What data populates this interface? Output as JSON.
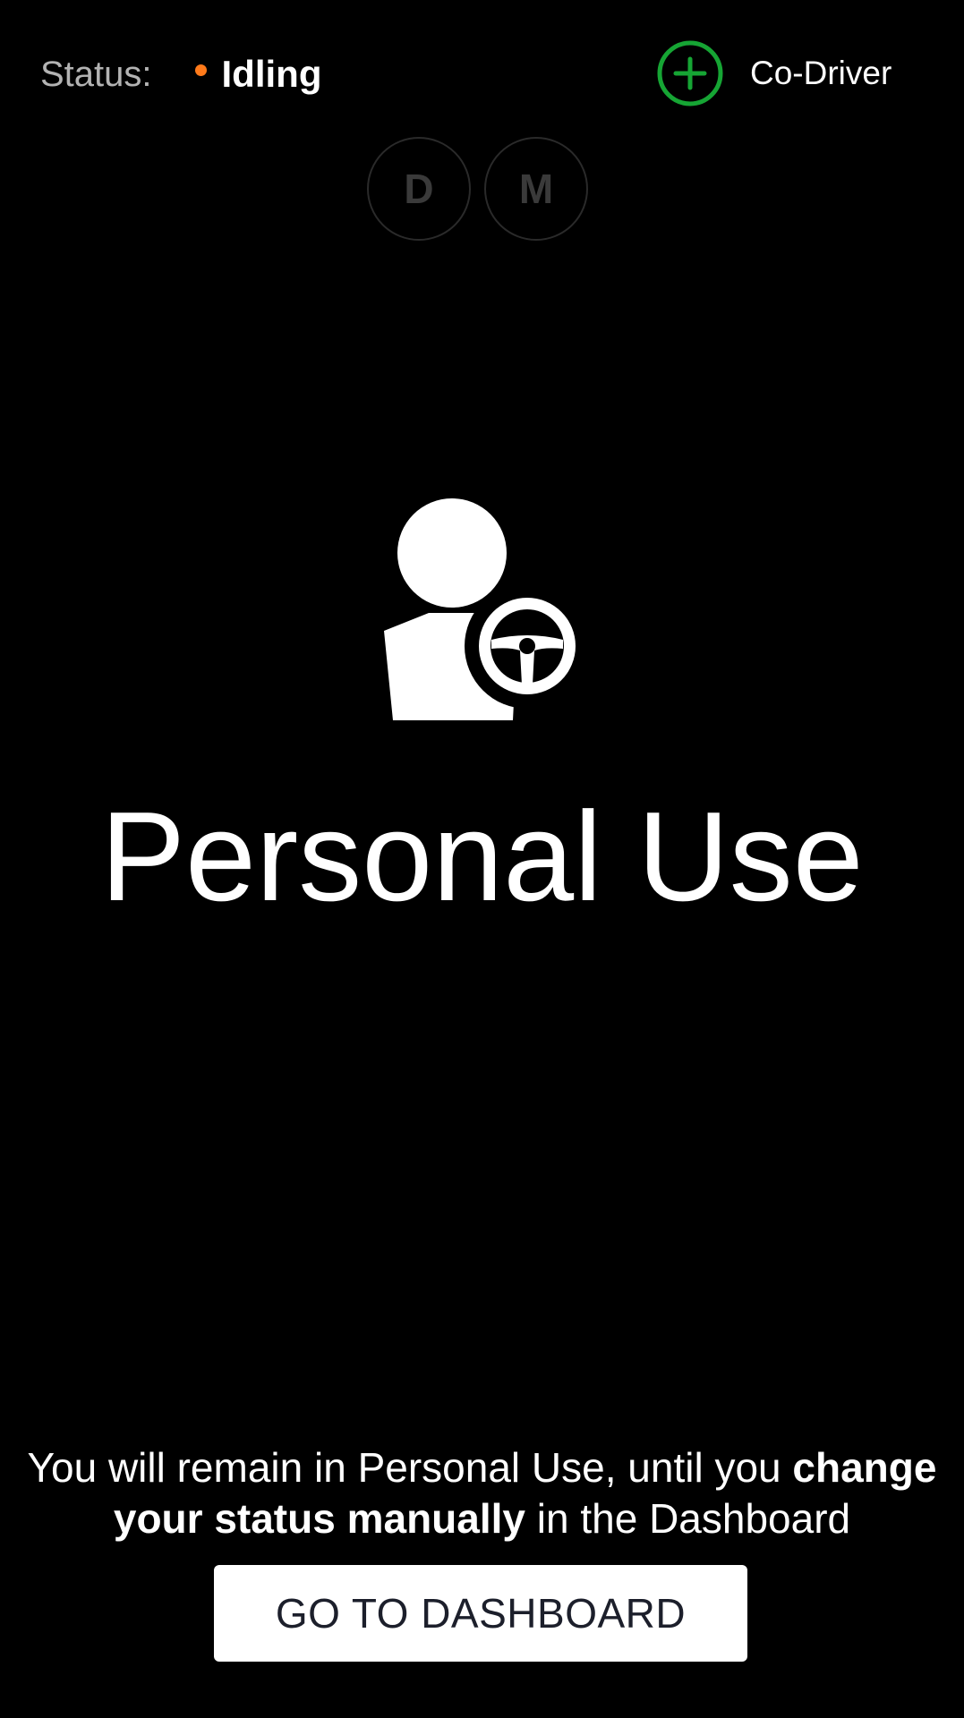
{
  "status": {
    "label": "Status:",
    "value": "Idling",
    "dot_color": "#ff7a1a"
  },
  "co_driver": {
    "label": "Co-Driver",
    "icon": "plus-circle-icon",
    "icon_color": "#16a534"
  },
  "log_circles": [
    {
      "letter": "D"
    },
    {
      "letter": "M"
    }
  ],
  "hero": {
    "icon": "driver-with-steering-wheel-icon",
    "title": "Personal Use"
  },
  "notice": {
    "part1": "You will remain in Personal Use, until you ",
    "bold": "change your status manually",
    "part2": " in the Dashboard"
  },
  "dashboard_button": {
    "label": "GO TO DASHBOARD"
  }
}
